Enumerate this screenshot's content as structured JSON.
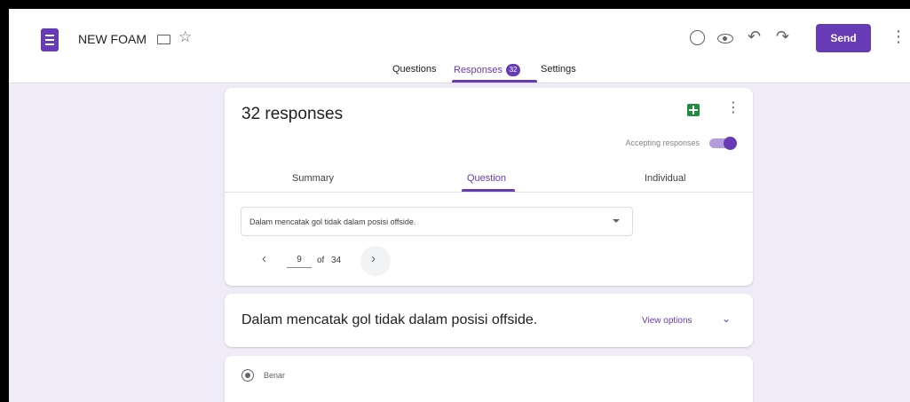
{
  "header": {
    "form_title": "NEW FOAM",
    "send_label": "Send",
    "icons": [
      "form-icon",
      "folder-icon",
      "star-icon",
      "palette-icon",
      "eye-icon",
      "undo-icon",
      "redo-icon",
      "more-vert-icon"
    ]
  },
  "tabs": {
    "questions": "Questions",
    "responses": "Responses",
    "responses_badge": "32",
    "settings": "Settings",
    "active": "Responses"
  },
  "responses_card": {
    "count_label": "32 responses",
    "accepting_label": "Accepting responses",
    "accepting": true,
    "sub_tabs": {
      "summary": "Summary",
      "question": "Question",
      "individual": "Individual",
      "active": "Question"
    },
    "question_select": "Dalam mencatak gol tidak dalam posisi offside.",
    "pager": {
      "current": "9",
      "of_label": "of",
      "total": "34"
    }
  },
  "question_card": {
    "title": "Dalam mencatak gol tidak dalam posisi offside.",
    "view_options": "View options"
  },
  "answer_card": {
    "option": "Benar",
    "selected": true
  },
  "colors": {
    "accent": "#673ab7",
    "background": "#f0ebf8",
    "sheets_green": "#1e8e3e"
  }
}
